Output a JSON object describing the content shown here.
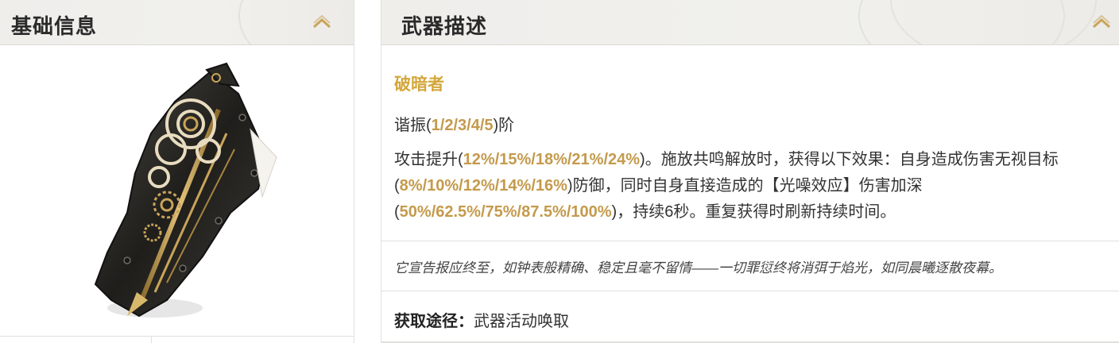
{
  "basic_info": {
    "title": "基础信息"
  },
  "weapon_desc": {
    "title": "武器描述",
    "name": "破暗者",
    "resonance": {
      "prefix": "谐振(",
      "levels": "1/2/3/4/5",
      "suffix": ")阶"
    },
    "effect": {
      "p1": "攻击提升(",
      "v1": "12%/15%/18%/21%/24%",
      "p2": ")。施放共鸣解放时，获得以下效果：自身造成伤害无视目标(",
      "v2": "8%/10%/12%/14%/16%",
      "p3": ")防御，同时自身直接造成的【光噪效应】伤害加深(",
      "v3": "50%/62.5%/75%/87.5%/100%",
      "p4": ")，持续6秒。重复获得时刷新持续时间。"
    },
    "flavor": "它宣告报应终至，如钟表般精确、稳定且毫不留情——一切罪愆终将消弭于焰光，如同晨曦逐散夜幕。",
    "obtain_label": "获取途径：",
    "obtain_value": "武器活动唤取"
  },
  "colors": {
    "accent_gold": "#d4a73c",
    "value_gold": "#c49a4c",
    "header_bg": "#efeeeb"
  },
  "icons": {
    "collapse": "chevron-up-icon",
    "weapon": "gauntlet-weapon-image"
  }
}
